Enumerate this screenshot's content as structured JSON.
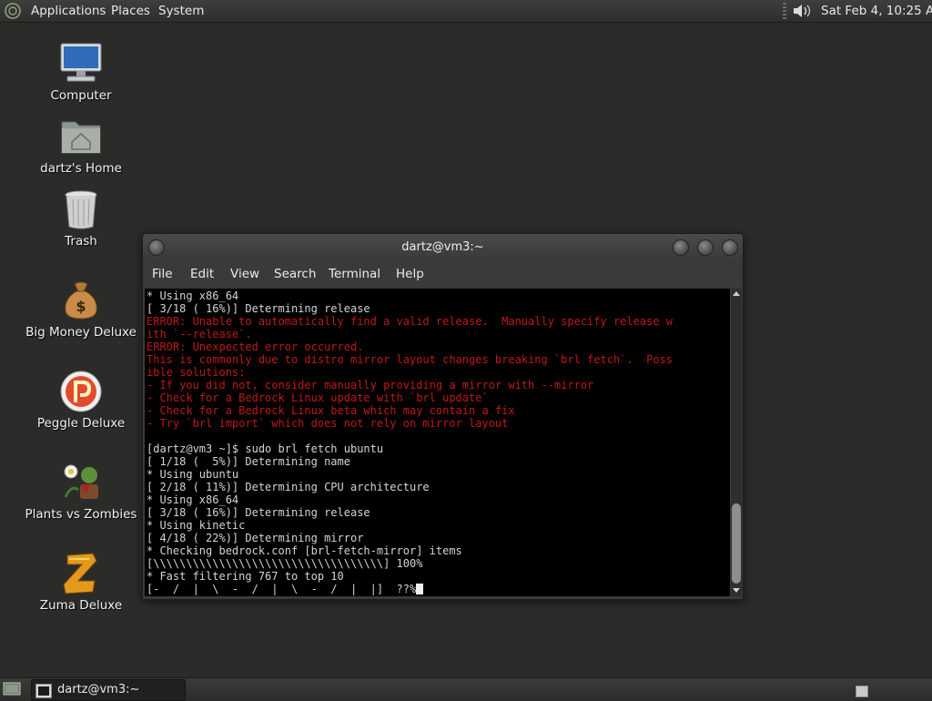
{
  "top_panel": {
    "menus": [
      "Applications",
      "Places",
      "System"
    ],
    "clock": "Sat Feb  4, 10:25 AM",
    "icons": [
      "distro-logo-icon",
      "volume-icon"
    ]
  },
  "desktop": {
    "icons": [
      {
        "label": "Computer",
        "icon": "computer-icon"
      },
      {
        "label": "dartz's Home",
        "icon": "home-folder-icon"
      },
      {
        "label": "Trash",
        "icon": "trash-icon"
      },
      {
        "label": "Big Money Deluxe",
        "icon": "money-bag-icon"
      },
      {
        "label": "Peggle Deluxe",
        "icon": "peggle-icon"
      },
      {
        "label": "Plants vs Zombies",
        "icon": "plants-vs-zombies-icon"
      },
      {
        "label": "Zuma Deluxe",
        "icon": "zuma-icon"
      }
    ]
  },
  "terminal": {
    "title": "dartz@vm3:~",
    "menus": [
      "File",
      "Edit",
      "View",
      "Search",
      "Terminal",
      "Help"
    ],
    "lines": [
      {
        "text": "* Using x86_64",
        "color": "default"
      },
      {
        "text": "[ 3/18 ( 16%)] Determining release",
        "color": "default"
      },
      {
        "text": "ERROR: Unable to automatically find a valid release.  Manually specify release w",
        "color": "err"
      },
      {
        "text": "ith `--release`.",
        "color": "err"
      },
      {
        "text": "ERROR: Unexpected error occurred.",
        "color": "err"
      },
      {
        "text": "This is commonly due to distro mirror layout changes breaking `brl fetch`.  Poss",
        "color": "err"
      },
      {
        "text": "ible solutions:",
        "color": "err"
      },
      {
        "text": "- If you did not, consider manually providing a mirror with --mirror",
        "color": "err"
      },
      {
        "text": "- Check for a Bedrock Linux update with `brl update`",
        "color": "err"
      },
      {
        "text": "- Check for a Bedrock Linux beta which may contain a fix",
        "color": "err"
      },
      {
        "text": "- Try `brl import` which does not rely on mirror layout",
        "color": "err"
      },
      {
        "text": "",
        "color": "default"
      },
      {
        "text": "[dartz@vm3 ~]$ sudo brl fetch ubuntu",
        "color": "default"
      },
      {
        "text": "[ 1/18 (  5%)] Determining name",
        "color": "default"
      },
      {
        "text": "* Using ubuntu",
        "color": "default"
      },
      {
        "text": "[ 2/18 ( 11%)] Determining CPU architecture",
        "color": "default"
      },
      {
        "text": "* Using x86_64",
        "color": "default"
      },
      {
        "text": "[ 3/18 ( 16%)] Determining release",
        "color": "default"
      },
      {
        "text": "* Using kinetic",
        "color": "default"
      },
      {
        "text": "[ 4/18 ( 22%)] Determining mirror",
        "color": "default"
      },
      {
        "text": "* Checking bedrock.conf [brl-fetch-mirror] items",
        "color": "default"
      },
      {
        "text": "[\\\\\\\\\\\\\\\\\\\\\\\\\\\\\\\\\\\\\\\\\\\\\\\\\\\\\\\\\\\\\\\\\\\\\\] 100%",
        "color": "default"
      },
      {
        "text": "* Fast filtering 767 to top 10",
        "color": "default"
      },
      {
        "text": "[-  /  |  \\  -  /  |  \\  -  /  |  |]  ??%",
        "color": "default"
      }
    ]
  },
  "taskbar": {
    "task_label": "dartz@vm3:~"
  }
}
